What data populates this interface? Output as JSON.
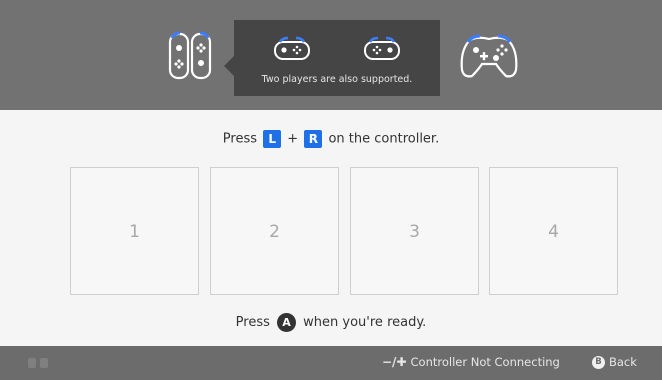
{
  "header": {
    "tooltip_text": "Two players are also supported.",
    "icons": [
      "joycon-pair-icon",
      "sideways-joycon-icon",
      "pro-controller-icon"
    ]
  },
  "instruction": {
    "prefix": "Press",
    "button_l": "L",
    "plus": "+",
    "button_r": "R",
    "suffix": "on the controller."
  },
  "slots": [
    {
      "label": "1"
    },
    {
      "label": "2"
    },
    {
      "label": "3"
    },
    {
      "label": "4"
    }
  ],
  "ready": {
    "prefix": "Press",
    "button": "A",
    "suffix": "when you're ready."
  },
  "footer": {
    "minus_plus": "−/✚",
    "controller_not_connecting": "Controller Not Connecting",
    "back_button_glyph": "B",
    "back_label": "Back"
  },
  "colors": {
    "header_bg": "#727272",
    "tooltip_bg": "#454545",
    "accent_blue": "#1f6fe6",
    "footer_bg": "#6c6c6c"
  }
}
